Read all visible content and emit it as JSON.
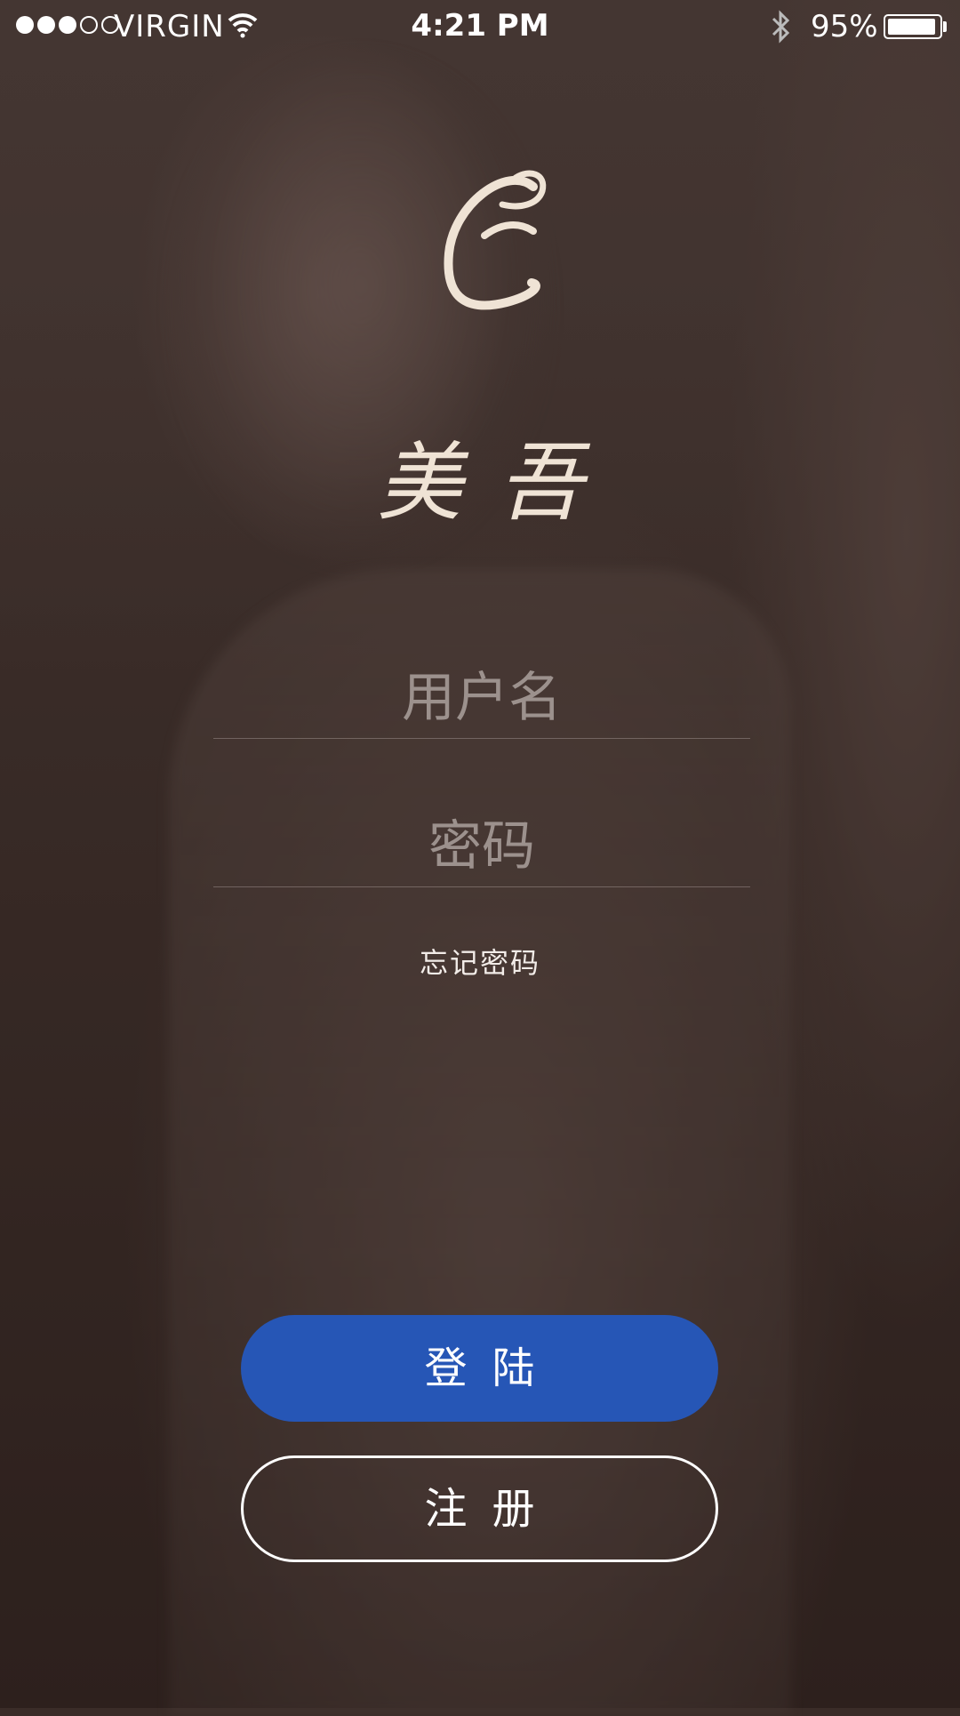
{
  "status_bar": {
    "signal_filled": 3,
    "signal_total": 5,
    "carrier": "VIRGIN",
    "time": "4:21 PM",
    "battery_percent_text": "95%",
    "battery_level": 0.95,
    "icons": [
      "wifi-icon",
      "bluetooth-icon",
      "battery-icon"
    ]
  },
  "brand": {
    "logo_letter": "E",
    "name": "美吾"
  },
  "form": {
    "username_placeholder": "用户名",
    "username_value": "",
    "password_placeholder": "密码",
    "password_value": "",
    "forgot_password": "忘记密码"
  },
  "buttons": {
    "login": "登陆",
    "register": "注册"
  },
  "colors": {
    "primary": "#2656b6",
    "logo": "#efe3d5",
    "background": "#3a2c28"
  }
}
